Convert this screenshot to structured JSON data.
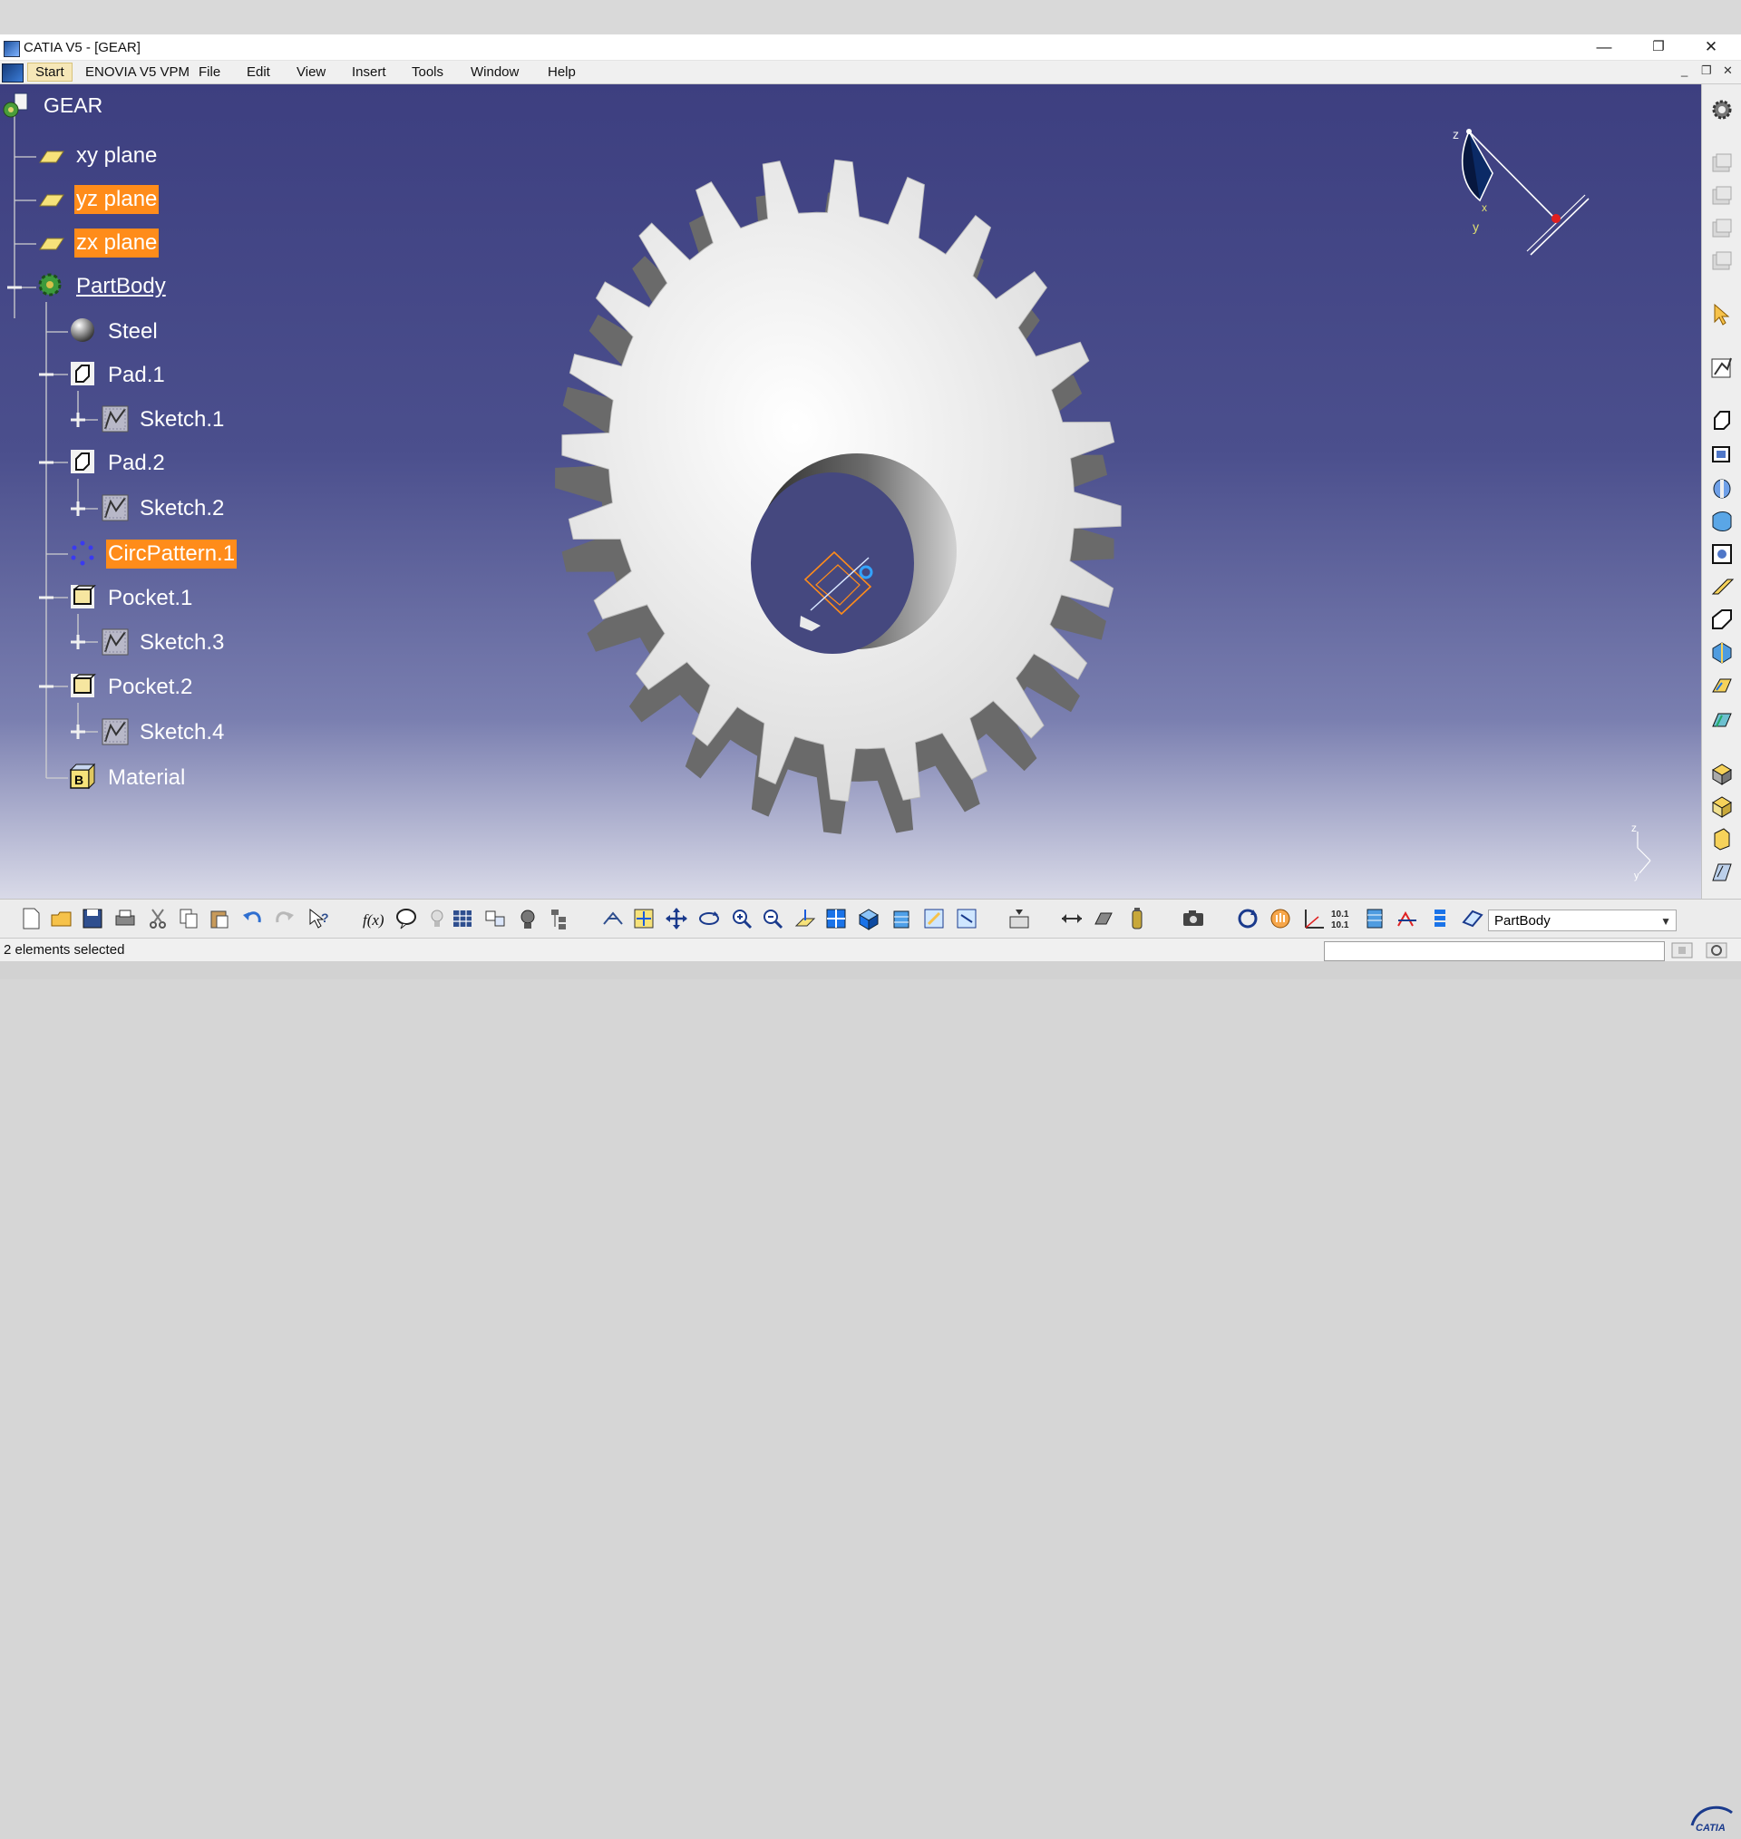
{
  "window": {
    "title": "CATIA V5 - [GEAR]",
    "minimize": "—",
    "restore": "❐",
    "close": "✕"
  },
  "menubar": {
    "items": [
      "Start",
      "ENOVIA V5 VPM",
      "File",
      "Edit",
      "View",
      "Insert",
      "Tools",
      "Window",
      "Help"
    ],
    "mdi_controls": [
      "_",
      "❐",
      "✕"
    ]
  },
  "tree": {
    "root": "GEAR",
    "nodes": [
      "xy plane",
      "yz plane",
      "zx plane",
      "PartBody",
      "Steel",
      "Pad.1",
      "Sketch.1",
      "Pad.2",
      "Sketch.2",
      "CircPattern.1",
      "Pocket.1",
      "Sketch.3",
      "Pocket.2",
      "Sketch.4",
      "Material"
    ]
  },
  "compass": {
    "axis_z": "z",
    "axis_x": "x",
    "axis_y": "y"
  },
  "axis_triad": {
    "z": "z",
    "y": "y"
  },
  "part_selector": {
    "value": "PartBody"
  },
  "status": {
    "text": "2 elements selected"
  },
  "colors": {
    "selection": "#ff8c1a",
    "viewport_top": "#3d3f80",
    "viewport_bottom": "#d9dae8"
  }
}
